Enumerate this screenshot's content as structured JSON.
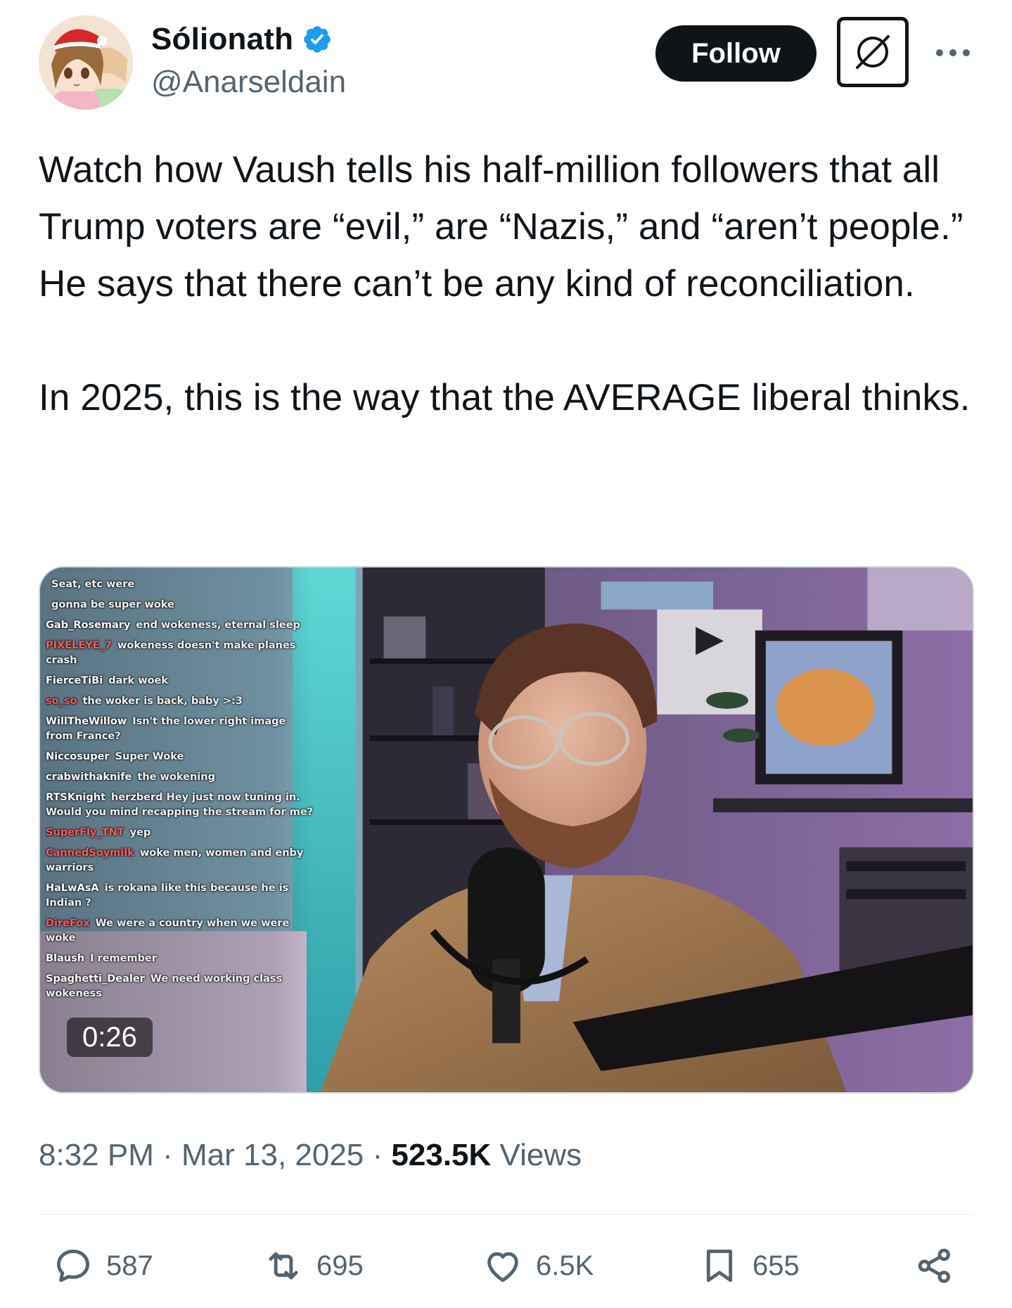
{
  "author": {
    "display_name": "Sólionath",
    "handle": "@Anarseldain",
    "verified": true,
    "avatar_icon": "anime-avatar"
  },
  "header": {
    "follow_label": "Follow",
    "grok_icon": "grok-icon",
    "more_icon": "more-icon"
  },
  "tweet": {
    "paragraphs": [
      "Watch how Vaush tells his half-million followers that all Trump voters are “evil,” are “Nazis,” and “aren’t people.” He says that there can’t be any kind of reconciliation.",
      "In 2025, this is the way that the AVERAGE liberal thinks."
    ]
  },
  "video": {
    "duration": "0:26",
    "chat": [
      {
        "user": "",
        "text": "Seat, etc were"
      },
      {
        "user": "",
        "text": "gonna be super woke"
      },
      {
        "user": "Gab_Rosemary",
        "text": "end wokeness, eternal sleep"
      },
      {
        "user": "PIXELEYE_7",
        "text": "wokeness doesn't make planes crash",
        "red": true
      },
      {
        "user": "FierceTiBi",
        "text": "dark woek"
      },
      {
        "user": "so_so",
        "text": "the woker is back, baby >:3",
        "red": true
      },
      {
        "user": "WillTheWillow",
        "text": "Isn't the lower right image from France?"
      },
      {
        "user": "Niccosuper",
        "text": "Super Woke"
      },
      {
        "user": "crabwithaknife",
        "text": "the wokening"
      },
      {
        "user": "RTSKnight",
        "text": "herzberd Hey just now tuning in. Would you mind recapping the stream for me?"
      },
      {
        "user": "SuperFly_TNT",
        "text": "yep",
        "red": true
      },
      {
        "user": "CannedSoymilk",
        "text": "woke men, women and enby warriors",
        "red": true
      },
      {
        "user": "HaLwAsA",
        "text": "is rokana like this because he is Indian ?"
      },
      {
        "user": "DireFox",
        "text": "We were a country when we were woke",
        "red": true
      },
      {
        "user": "Blaush",
        "text": "I remember"
      },
      {
        "user": "Spaghetti_Dealer",
        "text": "We need working class wokeness"
      }
    ]
  },
  "meta": {
    "time": "8:32 PM",
    "separator": "·",
    "date": "Mar 13, 2025",
    "views_count": "523.5K",
    "views_label": "Views"
  },
  "actions": {
    "replies": "587",
    "reposts": "695",
    "likes": "6.5K",
    "bookmarks": "655"
  },
  "colors": {
    "text": "#0f1419",
    "secondary": "#536471",
    "verified": "#1d9bf0",
    "divider": "#eff3f4"
  }
}
